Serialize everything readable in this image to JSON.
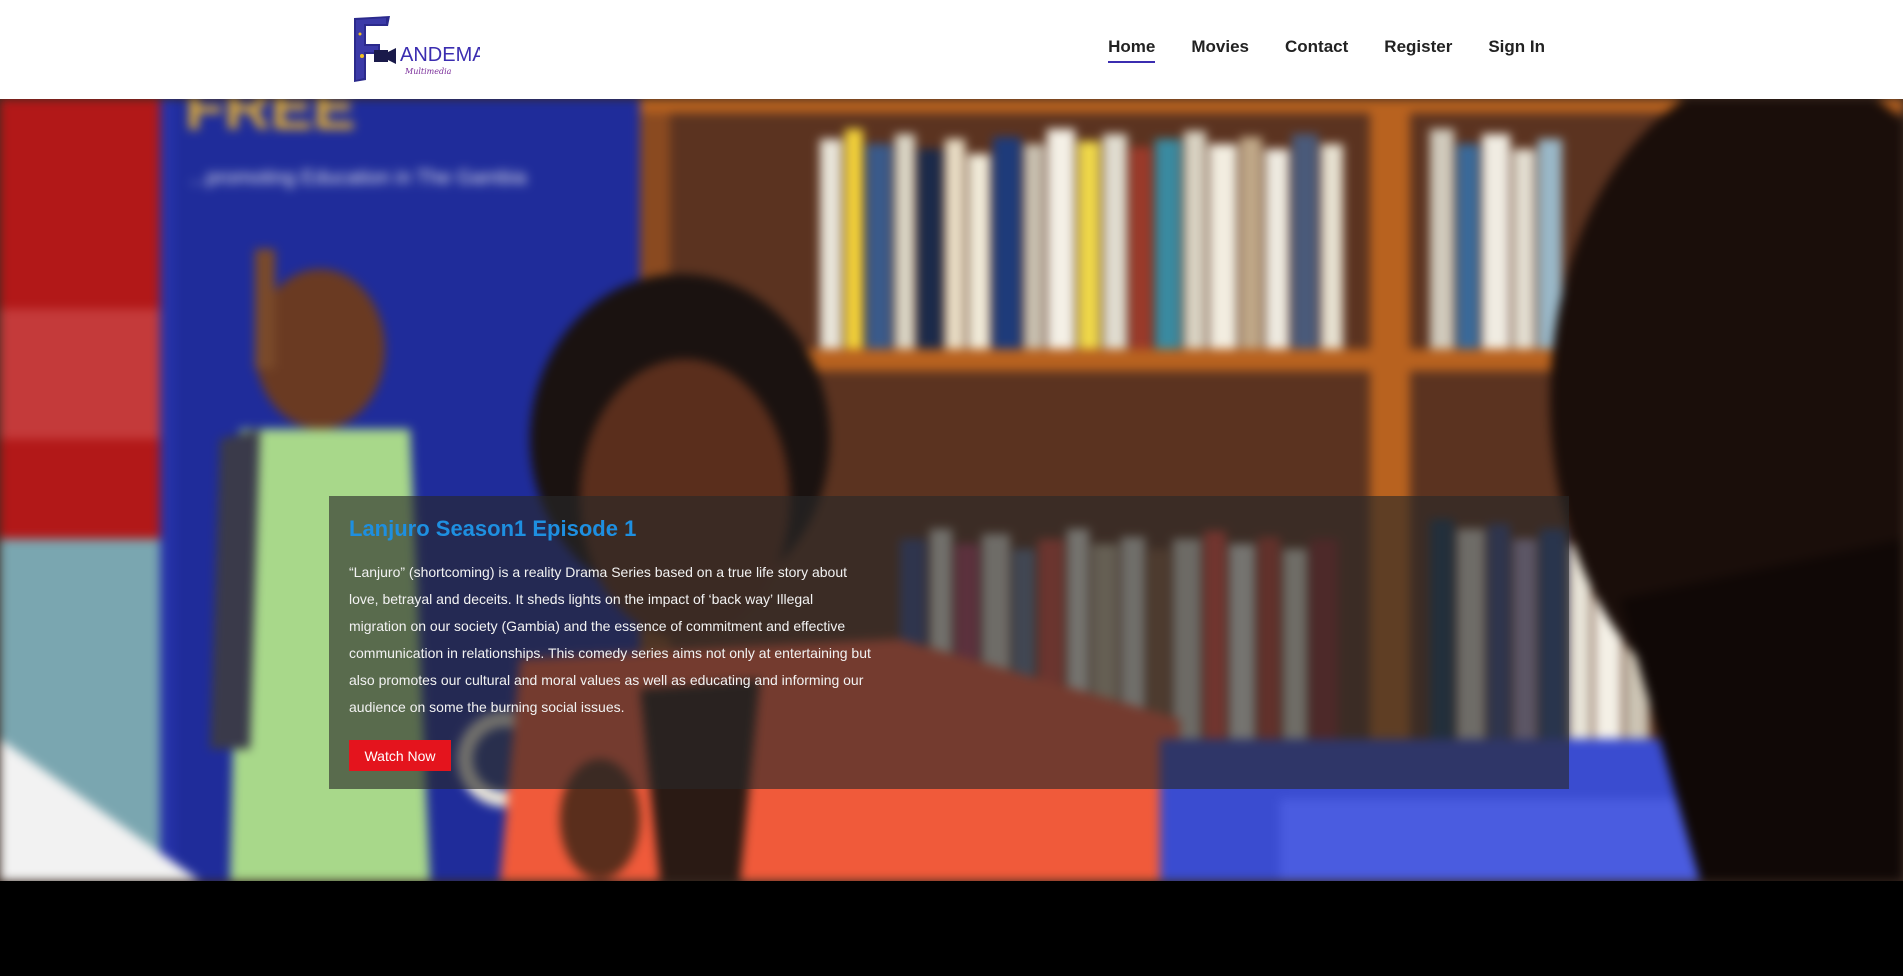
{
  "brand": {
    "name": "ANDEMA",
    "initial": "F",
    "tagline": "Multimedia"
  },
  "nav": {
    "items": [
      {
        "label": "Home",
        "active": true
      },
      {
        "label": "Movies",
        "active": false
      },
      {
        "label": "Contact",
        "active": false
      },
      {
        "label": "Register",
        "active": false
      },
      {
        "label": "Sign In",
        "active": false
      }
    ]
  },
  "hero": {
    "background_banner_text": "FREE",
    "background_banner_subtext": "...promoting Education in The Gambia",
    "title": "Lanjuro Season1 Episode 1",
    "description": "“Lanjuro” (shortcoming) is a reality Drama Series based on a true life story about love, betrayal and deceits. It sheds lights on the impact of ‘back way’ Illegal migration on our society (Gambia) and the essence of commitment and effective communication in relationships. This comedy series aims not only at entertaining but also promotes our cultural and moral values as well as educating and informing our audience on some the burning social issues.",
    "cta_label": "Watch Now"
  },
  "colors": {
    "title_blue": "#1e8fe0",
    "cta_red": "#e4141d",
    "nav_active_underline": "#3b2db0",
    "logo_purple": "#3b2db0"
  }
}
